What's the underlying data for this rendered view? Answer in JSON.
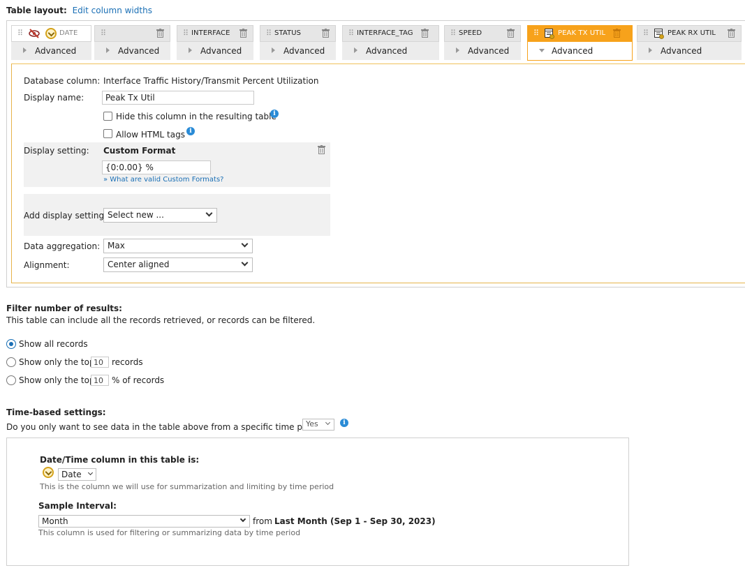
{
  "table_layout": {
    "label": "Table layout:",
    "edit_link": "Edit column widths"
  },
  "columns": [
    {
      "name": "DATE",
      "advanced": "Advanced",
      "icon": "clock-hidden-icon"
    },
    {
      "name": "",
      "advanced": "Advanced"
    },
    {
      "name": "INTERFACE",
      "advanced": "Advanced"
    },
    {
      "name": "STATUS",
      "advanced": "Advanced"
    },
    {
      "name": "INTERFACE_TAG",
      "advanced": "Advanced"
    },
    {
      "name": "SPEED",
      "advanced": "Advanced"
    },
    {
      "name": "PEAK TX UTIL",
      "advanced": "Advanced",
      "active": true
    },
    {
      "name": "PEAK RX UTIL",
      "advanced": "Advanced"
    }
  ],
  "advanced": {
    "db_column_label": "Database column:",
    "db_column_value": "Interface Traffic History/Transmit Percent Utilization",
    "display_name_label": "Display name:",
    "display_name_value": "Peak Tx Util",
    "hide_column_label": "Hide this column in the resulting table",
    "allow_html_label": "Allow HTML tags",
    "display_setting_label": "Display setting:",
    "custom_format_title": "Custom Format",
    "custom_format_value": "{0:0.00} %",
    "custom_format_help": "What are valid Custom Formats?",
    "add_display_label": "Add display settings:",
    "add_display_value": "Select new ...",
    "aggregation_label": "Data aggregation:",
    "aggregation_value": "Max",
    "alignment_label": "Alignment:",
    "alignment_value": "Center aligned"
  },
  "filter": {
    "title": "Filter number of results:",
    "description": "This table can include all the records retrieved, or records can be filtered.",
    "show_all": "Show all records",
    "top_prefix": "Show only the top",
    "top_value": "10",
    "top_suffix": "records",
    "pct_prefix": "Show only the top",
    "pct_value": "10",
    "pct_suffix": "% of records"
  },
  "time": {
    "title": "Time-based settings:",
    "question": "Do you only want to see data in the table above from a specific time period?",
    "question_value": "Yes",
    "datetime_title": "Date/Time column in this table is:",
    "datetime_value": "Date",
    "datetime_hint": "This is the column we will use for summarization and limiting by time period",
    "sample_title": "Sample Interval:",
    "sample_value": "Month",
    "from_text": "from",
    "range_text": "Last Month (Sep 1 - Sep 30, 2023)",
    "sample_hint": "This column is used for filtering or summarizing data by time period"
  }
}
